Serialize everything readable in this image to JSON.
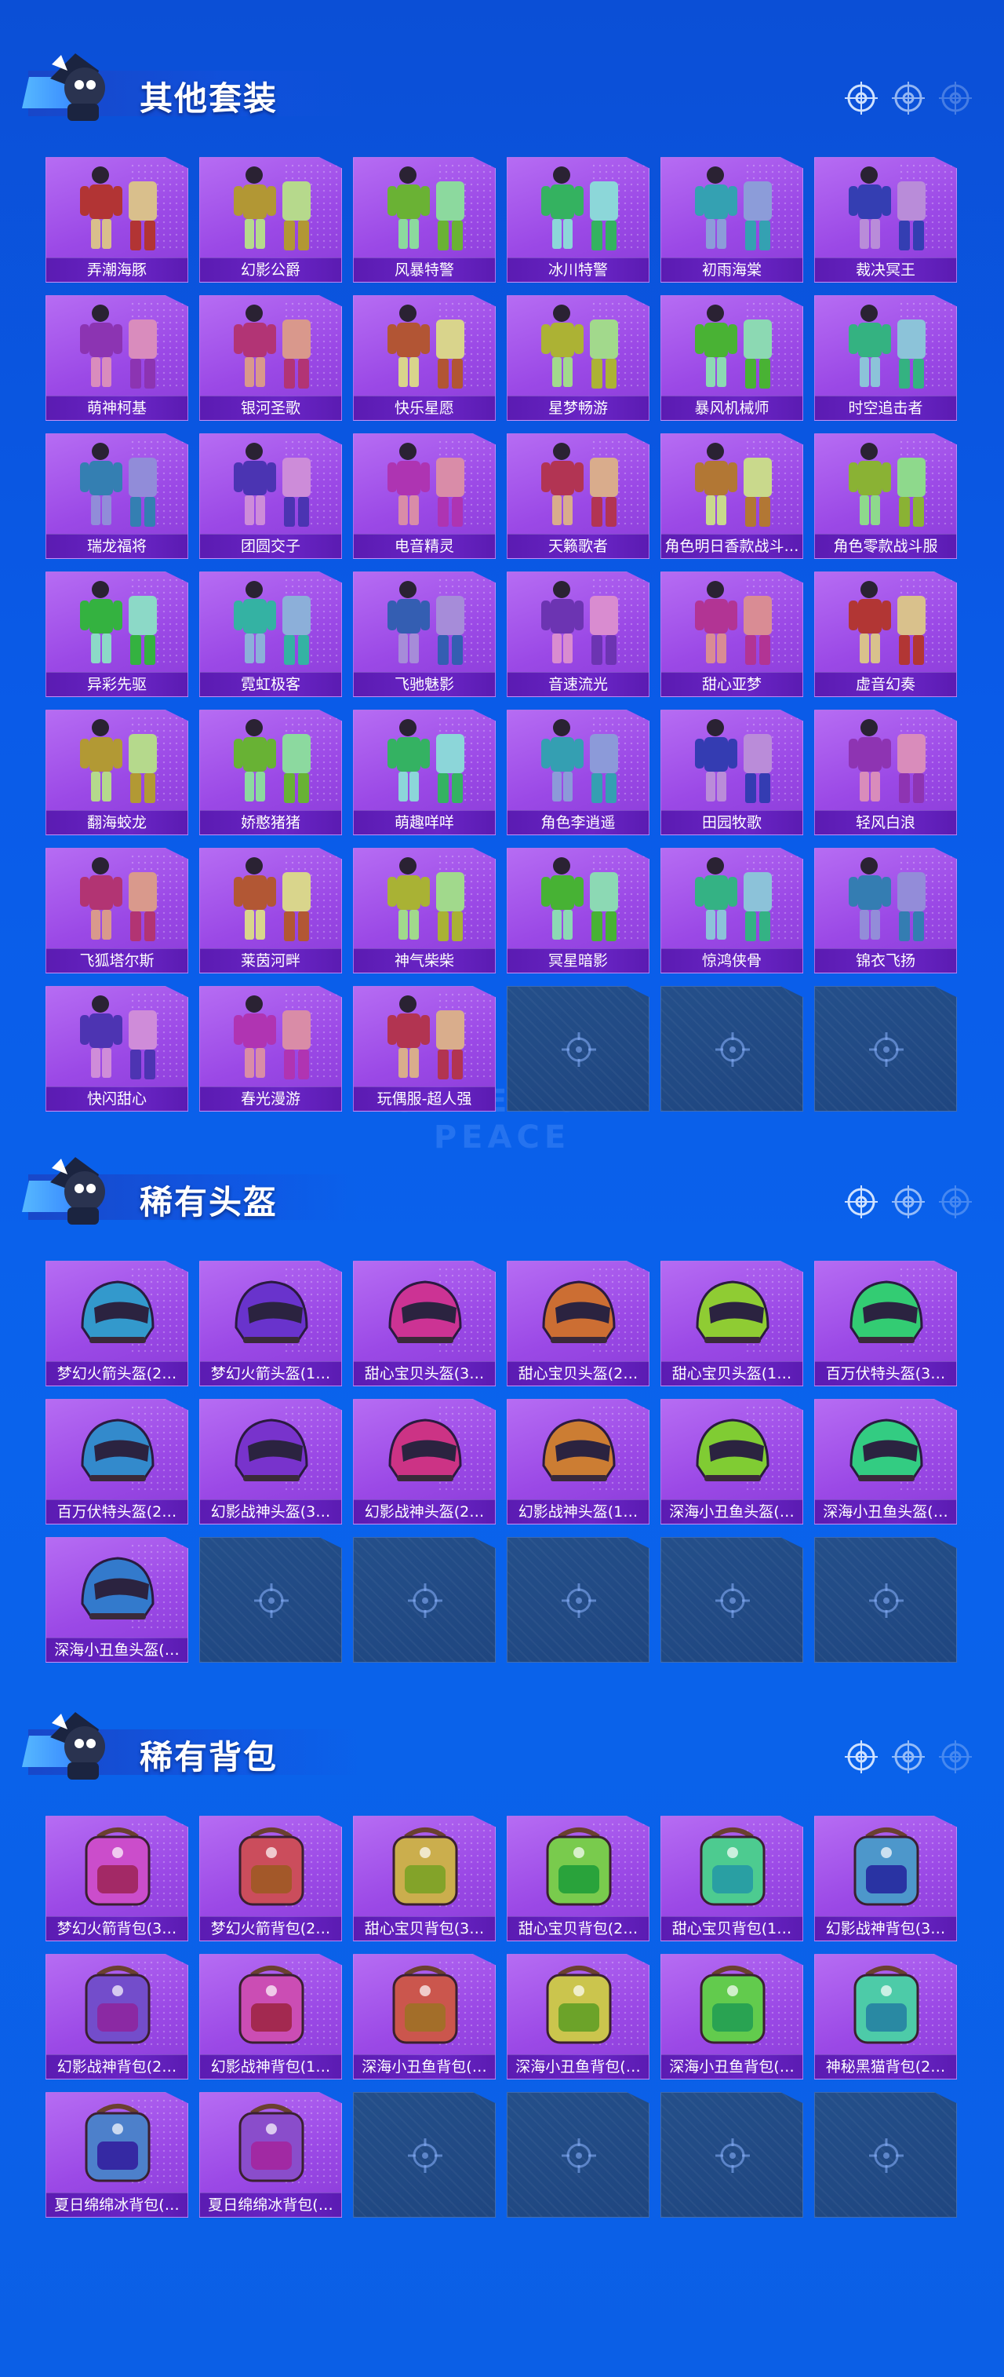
{
  "background": {
    "watermark": "GAME FOR PEACE"
  },
  "colors": {
    "card_bg": "#9b49e6",
    "card_label_bg": "#5b1bb2",
    "empty_card": "#244f8a",
    "page_bg": "#0a5be8"
  },
  "sections": [
    {
      "title": "其他套装",
      "icon": "mascot-icon",
      "items": [
        {
          "label": "弄潮海豚",
          "icon": "outfit-icon"
        },
        {
          "label": "幻影公爵",
          "icon": "outfit-icon"
        },
        {
          "label": "风暴特警",
          "icon": "outfit-icon"
        },
        {
          "label": "冰川特警",
          "icon": "outfit-icon"
        },
        {
          "label": "初雨海棠",
          "icon": "outfit-icon"
        },
        {
          "label": "裁决冥王",
          "icon": "outfit-icon"
        },
        {
          "label": "萌神柯基",
          "icon": "outfit-icon"
        },
        {
          "label": "银河圣歌",
          "icon": "outfit-icon"
        },
        {
          "label": "快乐星愿",
          "icon": "outfit-icon"
        },
        {
          "label": "星梦畅游",
          "icon": "outfit-icon"
        },
        {
          "label": "暴风机械师",
          "icon": "outfit-icon"
        },
        {
          "label": "时空追击者",
          "icon": "outfit-icon"
        },
        {
          "label": "瑞龙福将",
          "icon": "outfit-icon"
        },
        {
          "label": "团圆交子",
          "icon": "outfit-icon"
        },
        {
          "label": "电音精灵",
          "icon": "outfit-icon"
        },
        {
          "label": "天籁歌者",
          "icon": "outfit-icon"
        },
        {
          "label": "角色明日香款战斗…",
          "icon": "outfit-icon"
        },
        {
          "label": "角色零款战斗服",
          "icon": "outfit-icon"
        },
        {
          "label": "异彩先驱",
          "icon": "outfit-icon"
        },
        {
          "label": "霓虹极客",
          "icon": "outfit-icon"
        },
        {
          "label": "飞驰魅影",
          "icon": "outfit-icon"
        },
        {
          "label": "音速流光",
          "icon": "outfit-icon"
        },
        {
          "label": "甜心亚梦",
          "icon": "outfit-icon"
        },
        {
          "label": "虚音幻奏",
          "icon": "outfit-icon"
        },
        {
          "label": "翻海蛟龙",
          "icon": "outfit-icon"
        },
        {
          "label": "娇憨猪猪",
          "icon": "outfit-icon"
        },
        {
          "label": "萌趣咩咩",
          "icon": "outfit-icon"
        },
        {
          "label": "角色李逍遥",
          "icon": "outfit-icon"
        },
        {
          "label": "田园牧歌",
          "icon": "outfit-icon"
        },
        {
          "label": "轻风白浪",
          "icon": "outfit-icon"
        },
        {
          "label": "飞狐塔尔斯",
          "icon": "outfit-icon"
        },
        {
          "label": "莱茵河畔",
          "icon": "outfit-icon"
        },
        {
          "label": "神气柴柴",
          "icon": "outfit-icon"
        },
        {
          "label": "冥星暗影",
          "icon": "outfit-icon"
        },
        {
          "label": "惊鸿侠骨",
          "icon": "outfit-icon"
        },
        {
          "label": "锦衣飞扬",
          "icon": "outfit-icon"
        },
        {
          "label": "快闪甜心",
          "icon": "outfit-icon"
        },
        {
          "label": "春光漫游",
          "icon": "outfit-icon"
        },
        {
          "label": "玩偶服-超人强",
          "icon": "outfit-icon"
        }
      ],
      "empty_slots": 3
    },
    {
      "title": "稀有头盔",
      "icon": "mascot-icon",
      "items": [
        {
          "label": "梦幻火箭头盔(2…",
          "icon": "helmet-icon"
        },
        {
          "label": "梦幻火箭头盔(1…",
          "icon": "helmet-icon"
        },
        {
          "label": "甜心宝贝头盔(3…",
          "icon": "helmet-icon"
        },
        {
          "label": "甜心宝贝头盔(2…",
          "icon": "helmet-icon"
        },
        {
          "label": "甜心宝贝头盔(1…",
          "icon": "helmet-icon"
        },
        {
          "label": "百万伏特头盔(3…",
          "icon": "helmet-icon"
        },
        {
          "label": "百万伏特头盔(2…",
          "icon": "helmet-icon"
        },
        {
          "label": "幻影战神头盔(3…",
          "icon": "helmet-icon"
        },
        {
          "label": "幻影战神头盔(2…",
          "icon": "helmet-icon"
        },
        {
          "label": "幻影战神头盔(1…",
          "icon": "helmet-icon"
        },
        {
          "label": "深海小丑鱼头盔(…",
          "icon": "helmet-icon"
        },
        {
          "label": "深海小丑鱼头盔(…",
          "icon": "helmet-icon"
        },
        {
          "label": "深海小丑鱼头盔(…",
          "icon": "helmet-icon"
        }
      ],
      "empty_slots": 5
    },
    {
      "title": "稀有背包",
      "icon": "mascot-icon",
      "items": [
        {
          "label": "梦幻火箭背包(3…",
          "icon": "backpack-icon"
        },
        {
          "label": "梦幻火箭背包(2…",
          "icon": "backpack-icon"
        },
        {
          "label": "甜心宝贝背包(3…",
          "icon": "backpack-icon"
        },
        {
          "label": "甜心宝贝背包(2…",
          "icon": "backpack-icon"
        },
        {
          "label": "甜心宝贝背包(1…",
          "icon": "backpack-icon"
        },
        {
          "label": "幻影战神背包(3…",
          "icon": "backpack-icon"
        },
        {
          "label": "幻影战神背包(2…",
          "icon": "backpack-icon"
        },
        {
          "label": "幻影战神背包(1…",
          "icon": "backpack-icon"
        },
        {
          "label": "深海小丑鱼背包(…",
          "icon": "backpack-icon"
        },
        {
          "label": "深海小丑鱼背包(…",
          "icon": "backpack-icon"
        },
        {
          "label": "深海小丑鱼背包(…",
          "icon": "backpack-icon"
        },
        {
          "label": "神秘黑猫背包(2…",
          "icon": "backpack-icon"
        },
        {
          "label": "夏日绵绵冰背包(…",
          "icon": "backpack-icon"
        },
        {
          "label": "夏日绵绵冰背包(…",
          "icon": "backpack-icon"
        }
      ],
      "empty_slots": 4
    }
  ]
}
